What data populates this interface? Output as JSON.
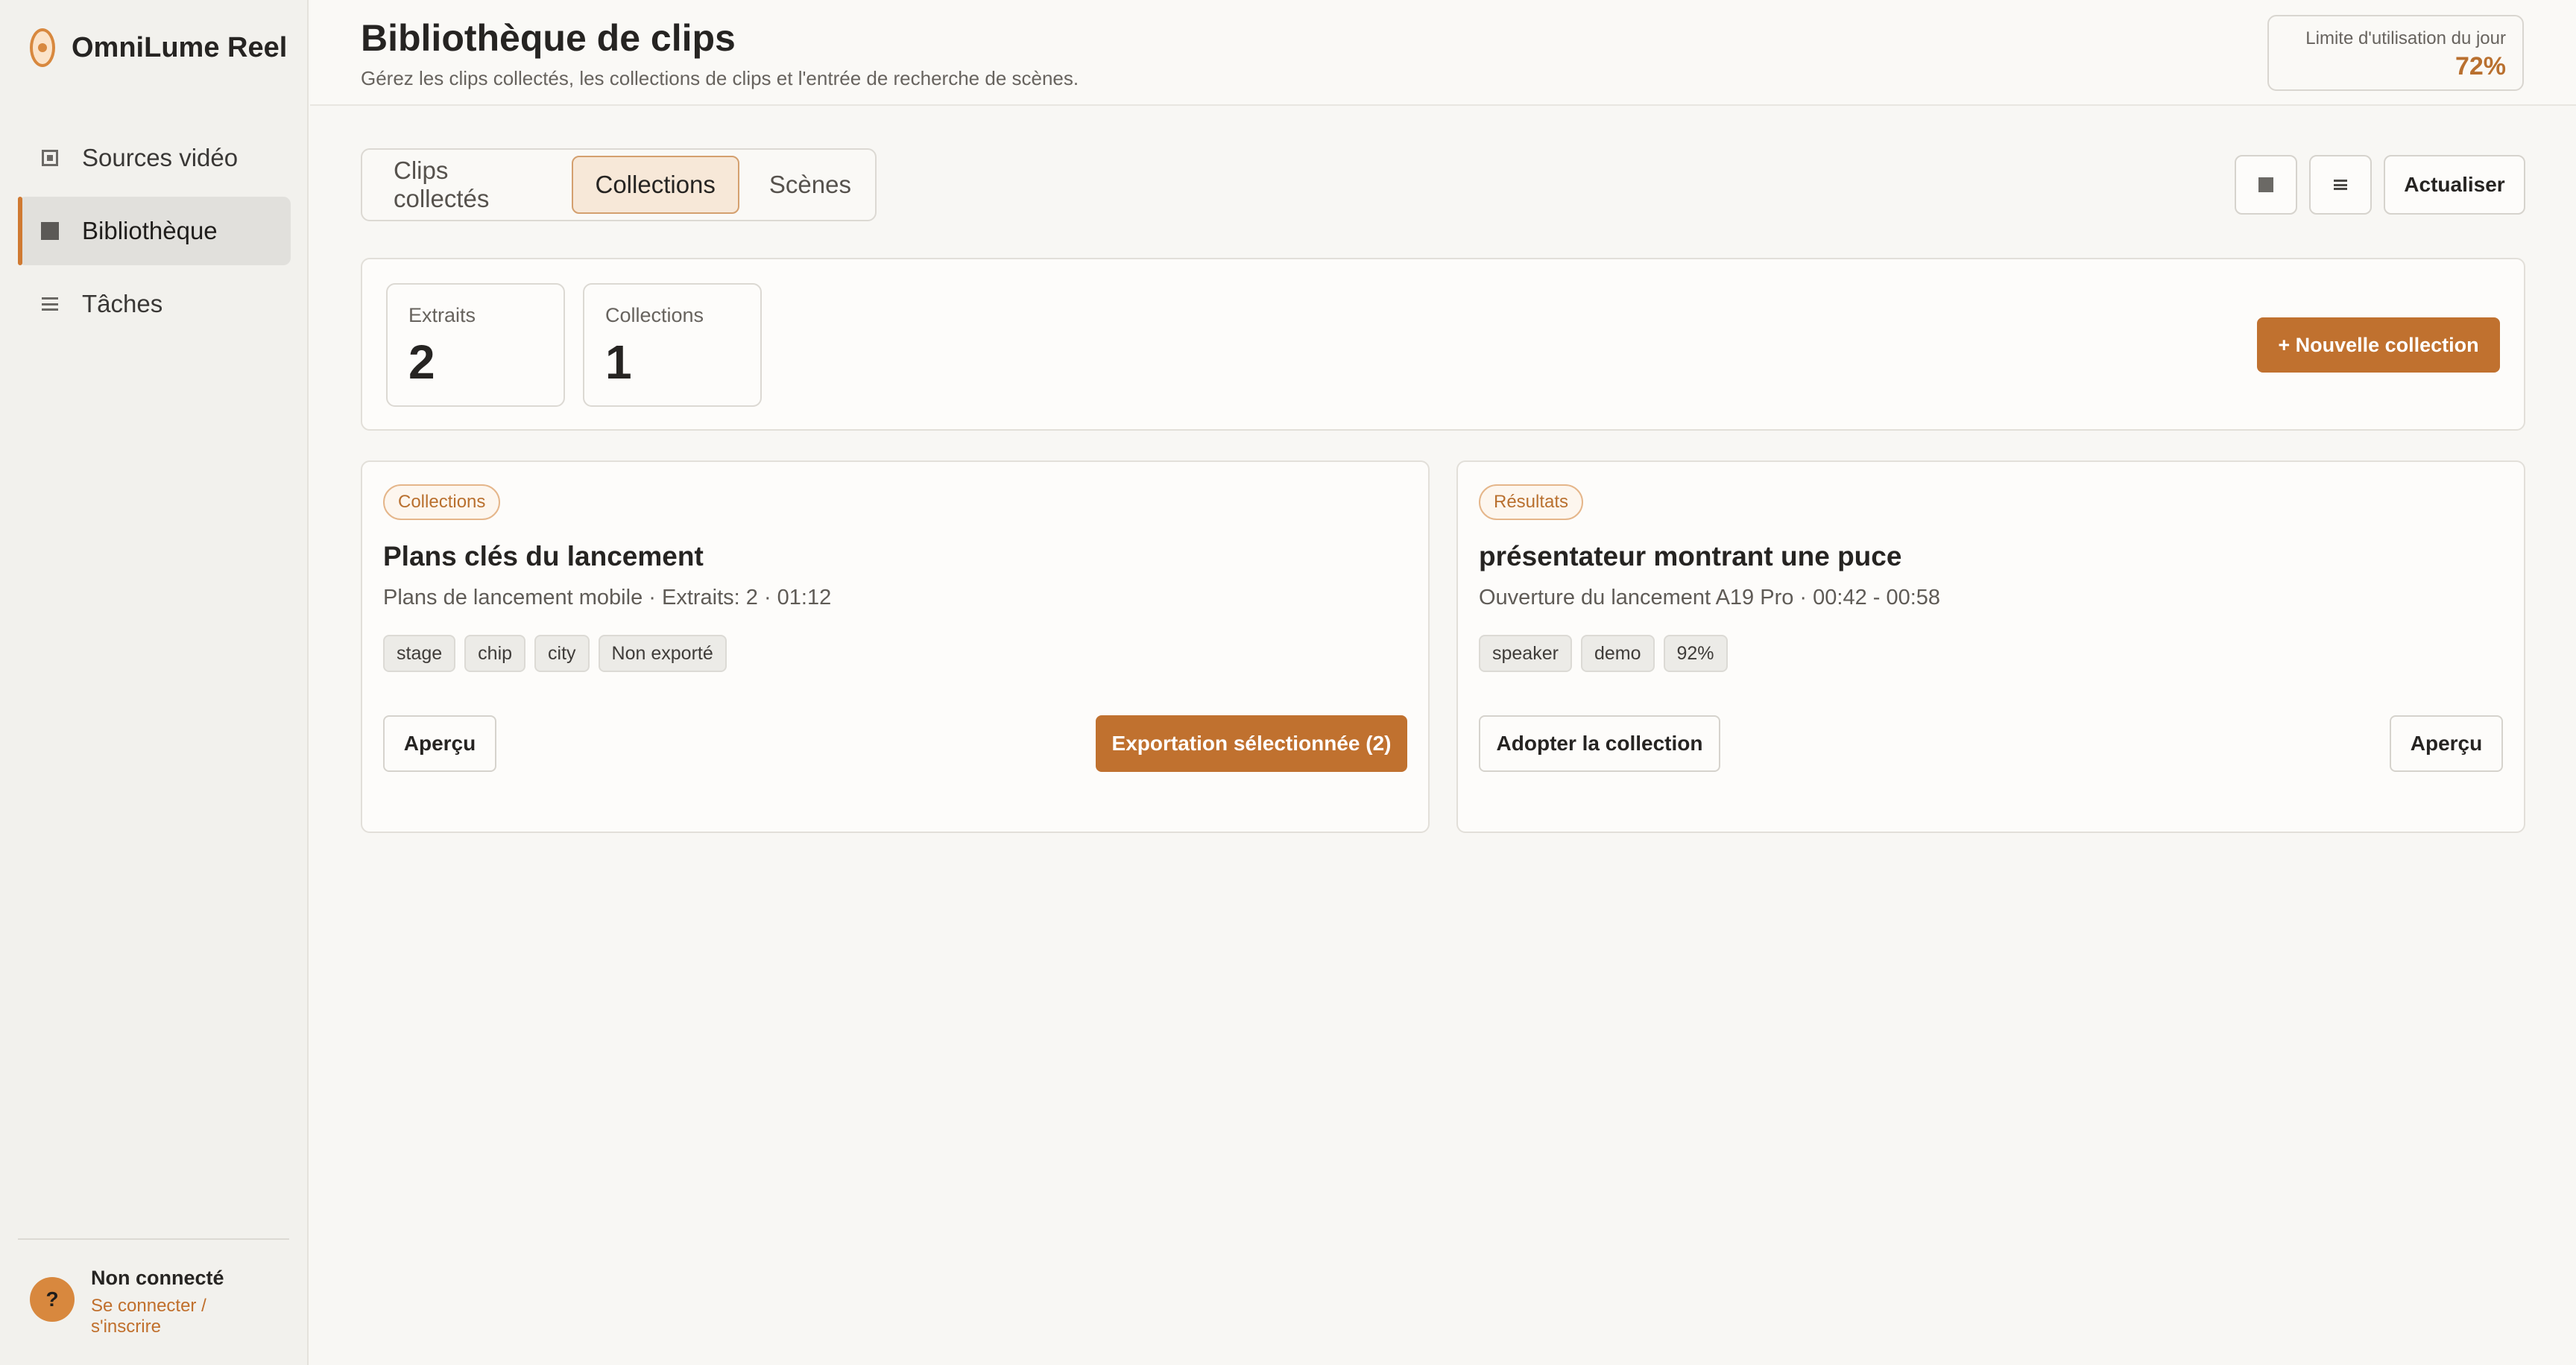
{
  "app": {
    "name": "OmniLume Reel"
  },
  "sidebar": {
    "items": [
      {
        "label": "Sources vidéo",
        "icon": "video-source-icon",
        "active": false
      },
      {
        "label": "Bibliothèque",
        "icon": "library-icon",
        "active": true
      },
      {
        "label": "Tâches",
        "icon": "tasks-icon",
        "active": false
      }
    ],
    "user": {
      "avatar": "?",
      "status": "Non connecté",
      "login_link": "Se connecter / s'inscrire"
    }
  },
  "header": {
    "title": "Bibliothèque de clips",
    "subtitle": "Gérez les clips collectés, les collections de clips et l'entrée de recherche de scènes.",
    "usage_label": "Limite d'utilisation du jour",
    "usage_value": "72%"
  },
  "tabs": [
    {
      "label": "Clips collectés",
      "active": false
    },
    {
      "label": "Collections",
      "active": true
    },
    {
      "label": "Scènes",
      "active": false
    }
  ],
  "toolbar": {
    "grid_icon": "grid-view-icon",
    "list_icon": "list-view-icon",
    "refresh_label": "Actualiser"
  },
  "stats": [
    {
      "label": "Extraits",
      "value": "2"
    },
    {
      "label": "Collections",
      "value": "1"
    }
  ],
  "new_collection_label": "+ Nouvelle collection",
  "cards": [
    {
      "badge": "Collections",
      "title": "Plans clés du lancement",
      "meta": "Plans de lancement mobile · Extraits: 2 · 01:12",
      "tags": [
        "stage",
        "chip",
        "city",
        "Non exporté"
      ],
      "secondary_action": "Aperçu",
      "primary_action": "Exportation sélectionnée (2)"
    },
    {
      "badge": "Résultats",
      "title": "présentateur montrant une puce",
      "meta": "Ouverture du lancement A19 Pro · 00:42 - 00:58",
      "tags": [
        "speaker",
        "demo",
        "92%"
      ],
      "left_action": "Adopter la collection",
      "right_action": "Aperçu"
    }
  ],
  "colors": {
    "accent": "#c0712f",
    "accent_light": "#f7e8d8",
    "background": "#f8f7f4",
    "sidebar": "#f2f1ed"
  }
}
